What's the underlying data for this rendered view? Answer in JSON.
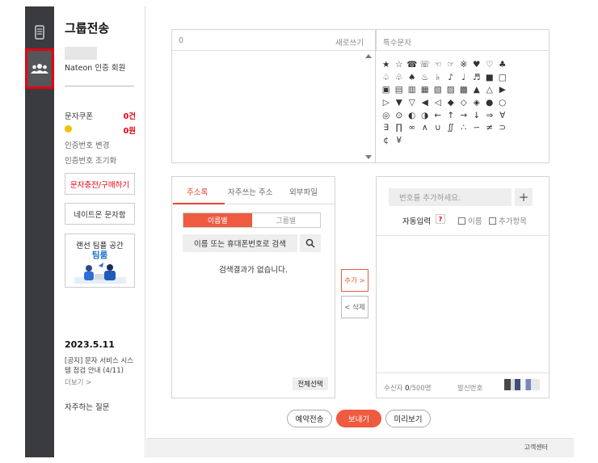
{
  "sidebar": {
    "title": "그룹전송",
    "member_label": "Nateon 인증 회원",
    "coupon_label": "문자쿠폰",
    "coupon_value": "0건",
    "coin_value": "0원",
    "change_auth": "인증번호 변경",
    "reset_auth": "인증번호 조기화",
    "charge_button": "문자충전/구매하기",
    "nateon_button": "네이트온 문자함",
    "banner_line1": "랜선 팀플 공간",
    "banner_line2": "팀룸",
    "notice_date": "2023.5.11",
    "notice_text": "[공지] 문자 서비스 시스템 점검 안내 (4/11)",
    "notice_more": "더보기 >",
    "faq": "자주하는 질문"
  },
  "message": {
    "char_count": "0",
    "rewrite_label": "새로쓰기"
  },
  "symbols": {
    "title": "특수문자",
    "items": [
      "★",
      "☆",
      "☎",
      "☏",
      "☜",
      "☞",
      "※",
      "♥",
      "♡",
      "♣",
      "♤",
      "♧",
      "♠",
      "♨",
      "♭",
      "♪",
      "♩",
      "♬",
      "■",
      "□",
      "▣",
      "▤",
      "▥",
      "▦",
      "▧",
      "▨",
      "▩",
      "▲",
      "△",
      "▶",
      "▷",
      "▼",
      "▽",
      "◀",
      "◁",
      "◆",
      "◇",
      "◈",
      "●",
      "○",
      "◎",
      "⊙",
      "◐",
      "◑",
      "←",
      "↑",
      "→",
      "↓",
      "⇒",
      "∀",
      "∃",
      "∏",
      "∞",
      "∧",
      "∪",
      "∬",
      "∴",
      "∽",
      "≠",
      "⊃",
      "¢",
      "¥"
    ]
  },
  "addressbook": {
    "tabs": [
      "주소록",
      "자주쓰는 주소",
      "외부파일"
    ],
    "seg_by_name": "이름별",
    "seg_by_group": "그룹별",
    "search_placeholder": "이름 또는 휴대폰번호로 검색",
    "empty_text": "검색결과가 없습니다.",
    "select_all": "전체선택"
  },
  "transfer": {
    "add_label": "추가 >",
    "delete_label": "< 삭제"
  },
  "recipients": {
    "number_placeholder": "번호를 추가하세요.",
    "plus": "+",
    "auto_input": "자동입력",
    "help": "?",
    "opt_name": "이름",
    "opt_extra": "추가항목",
    "count_label": "수신자",
    "count_value": "0",
    "count_max": "/500명",
    "sender_label": "발신번호"
  },
  "actions": {
    "reserve": "예약전송",
    "send": "보내기",
    "preview": "미리보기"
  },
  "footer": {
    "help_center": "고객센터"
  },
  "colors": {
    "accent": "#ee5b40",
    "rail": "#3a3b3f",
    "highlight": "#e60012"
  }
}
